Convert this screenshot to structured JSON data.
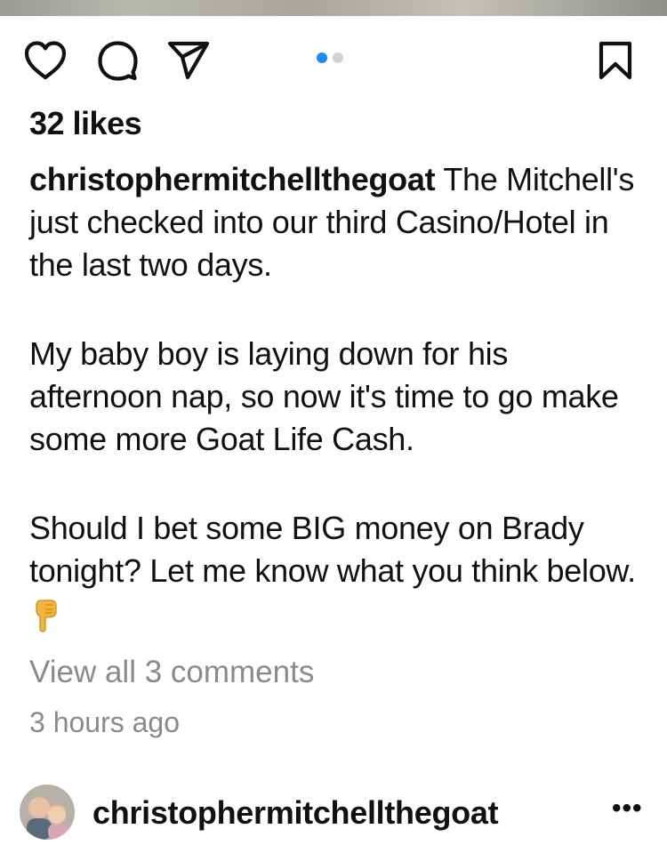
{
  "post": {
    "likes_text": "32 likes",
    "carousel": {
      "count": 2,
      "active_index": 0
    },
    "caption": {
      "username": "christophermitchellthegoat",
      "line1_text": " The Mitchell's just checked into our third Casino/Hotel in the last two days.",
      "paragraph2": "My baby boy is laying down for his afternoon nap, so now it's time to go make some more Goat Life Cash.",
      "paragraph3": "Should I bet some BIG money on Brady tonight? Let me know what you think below."
    },
    "view_comments_text": "View all 3 comments",
    "timestamp": "3 hours ago"
  },
  "actions": {
    "icons": [
      "heart-icon",
      "comment-icon",
      "share-icon",
      "bookmark-icon"
    ]
  },
  "next_post": {
    "username": "christophermitchellthegoat",
    "more_label": "•••"
  },
  "colors": {
    "carousel_active": "#1b8cf0",
    "secondary_text": "#8a8a8a"
  }
}
